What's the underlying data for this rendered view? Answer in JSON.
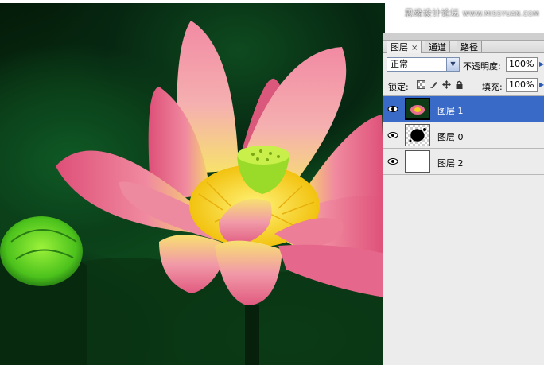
{
  "watermark": {
    "text": "思缘设计论坛",
    "site": "WWW.MISSYUAN.COM"
  },
  "panel": {
    "tabs": [
      {
        "label": "图层",
        "close": "×",
        "active": true
      },
      {
        "label": "通道",
        "active": false
      },
      {
        "label": "路径",
        "active": false
      }
    ],
    "blend_mode": "正常",
    "opacity_label": "不透明度:",
    "opacity_value": "100%",
    "lock_label": "锁定:",
    "fill_label": "填充:",
    "fill_value": "100%",
    "layers": [
      {
        "name": "图层 1",
        "selected": true,
        "visible": true,
        "thumb": "lotus-photo"
      },
      {
        "name": "图层 0",
        "selected": false,
        "visible": true,
        "thumb": "black-blob-on-transparent"
      },
      {
        "name": "图层 2",
        "selected": false,
        "visible": true,
        "thumb": "white-fill"
      }
    ]
  },
  "colors": {
    "selection": "#3a6ac7",
    "panel_bg": "#ececec",
    "petal": "#e8708f",
    "petal_light": "#f5a8b6",
    "stamen": "#f2d21a",
    "seed_pod": "#b7e23a",
    "leaf": "#1a6e2f"
  }
}
